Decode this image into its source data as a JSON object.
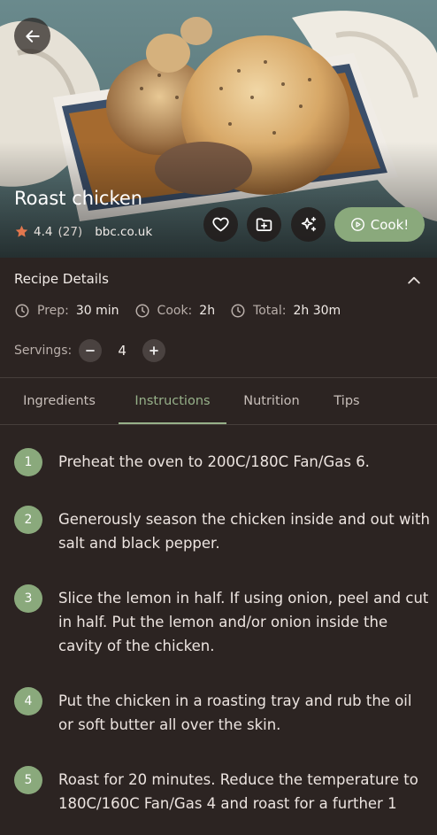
{
  "recipe": {
    "title": "Roast chicken",
    "rating": "4.4",
    "rating_count": "(27)",
    "source": "bbc.co.uk",
    "cook_label": "Cook!"
  },
  "details": {
    "title": "Recipe Details",
    "prep_label": "Prep:",
    "prep_value": "30 min",
    "cook_label": "Cook:",
    "cook_value": "2h",
    "total_label": "Total:",
    "total_value": "2h 30m",
    "servings_label": "Servings:",
    "servings_value": "4"
  },
  "tabs": [
    {
      "label": "Ingredients"
    },
    {
      "label": "Instructions"
    },
    {
      "label": "Nutrition"
    },
    {
      "label": "Tips"
    }
  ],
  "active_tab": "Instructions",
  "steps": [
    {
      "n": "1",
      "text": "Preheat the oven to 200C/180C Fan/Gas 6."
    },
    {
      "n": "2",
      "text": "Generously season the chicken inside and out with salt and black pepper."
    },
    {
      "n": "3",
      "text": "Slice the lemon in half. If using onion, peel and cut in half. Put the lemon and/or onion inside the cavity of the chicken."
    },
    {
      "n": "4",
      "text": "Put the chicken in a roasting tray and rub the oil or soft butter all over the skin."
    },
    {
      "n": "5",
      "text": "Roast for 20 minutes. Reduce the temperature to 180C/160C Fan/Gas 4 and roast for a further 1"
    }
  ],
  "colors": {
    "accent": "#8aa97c",
    "background": "#2c2422",
    "star": "#e2774e"
  },
  "icons": {
    "back": "arrow-left-icon",
    "favorite": "heart-icon",
    "save": "folder-plus-icon",
    "ai": "sparkles-icon",
    "cook": "play-circle-icon",
    "collapse": "chevron-up-icon",
    "time": "clock-icon",
    "minus": "minus-icon",
    "plus": "plus-icon",
    "rating": "star-icon"
  }
}
